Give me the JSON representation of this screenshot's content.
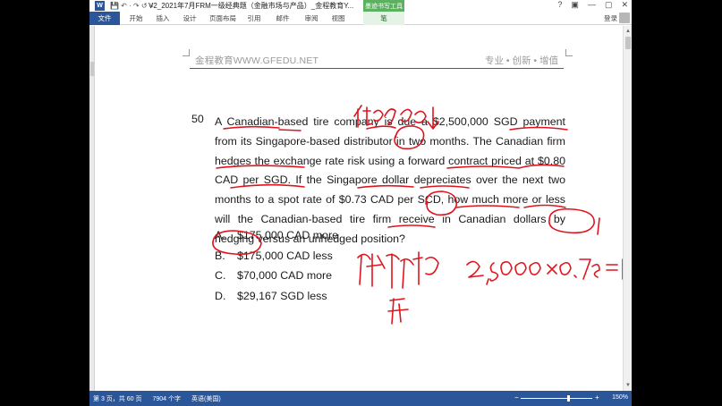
{
  "titlebar": {
    "app_icon": "W",
    "quick_access": "💾 ↶ · ↷ ↺ ≡",
    "title": "V2_2021年7月FRM一级经典题（金融市场与产品）_金程教育Y...",
    "context_title": "墨迹书写工具",
    "controls": [
      "?",
      "▣",
      "—",
      "▢",
      "✕"
    ]
  },
  "ribbon": {
    "file": "文件",
    "tabs": [
      "开始",
      "插入",
      "设计",
      "页面布局",
      "引用",
      "邮件",
      "审阅",
      "视图"
    ],
    "context_tab": "笔",
    "login": "登录"
  },
  "header": {
    "left": "金程教育WWW.GFEDU.NET",
    "right": "专业 • 创新 • 增值"
  },
  "question": {
    "number": "50",
    "text": "A Canadian-based tire company is due a $2,500,000 SGD payment from its Singapore-based distributor in two months. The Canadian firm hedges the exchange rate risk using a forward contract priced at $0.80 CAD per SGD. If the Singapore dollar depreciates over the next two months to a spot rate of $0.73 CAD per SCD, how much more or less will the Canadian-based tire firm receive in Canadian dollars by hedging versus an unhedged position?",
    "choices": [
      {
        "label": "A.",
        "text": "$175,000 CAD more"
      },
      {
        "label": "B.",
        "text": "$175,000 CAD less"
      },
      {
        "label": "C.",
        "text": "$70,000 CAD more"
      },
      {
        "label": "D.",
        "text": "$29,167 SGD less"
      }
    ]
  },
  "statusbar": {
    "page": "第 3 页，共 60 页",
    "words": "7904 个字",
    "lang": "英语(美国)",
    "zoom": "150%"
  }
}
